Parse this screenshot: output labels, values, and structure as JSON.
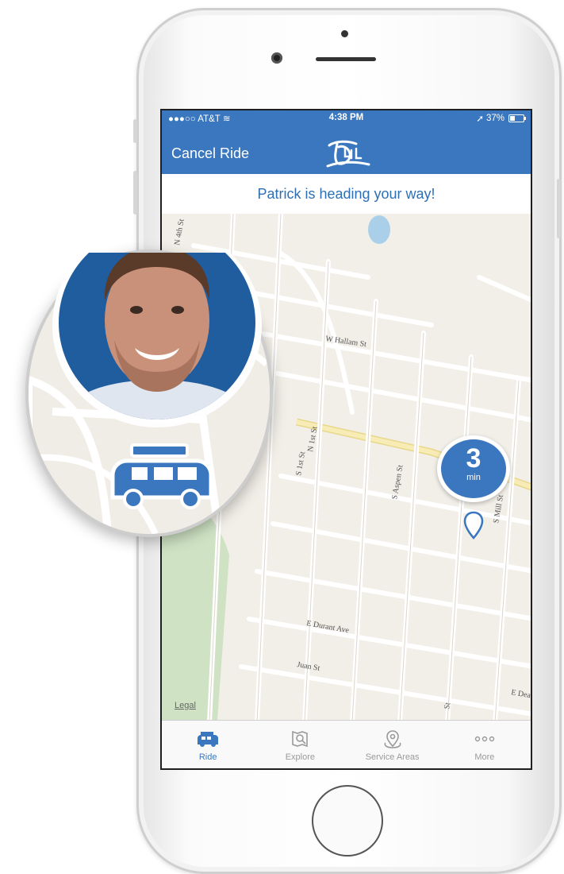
{
  "status_bar": {
    "carrier": "●●●○○ AT&T",
    "time": "4:38 PM",
    "battery": "37%"
  },
  "nav": {
    "cancel_label": "Cancel Ride"
  },
  "banner": {
    "message": "Patrick is heading your way!"
  },
  "eta": {
    "value": "3",
    "unit": "min"
  },
  "map": {
    "legal_label": "Legal",
    "streets": [
      "N 4th St",
      "W Hallam St",
      "N 1st St",
      "S 1st St",
      "S Aspen St",
      "S Mill St",
      "E Durant Ave",
      "Juan St",
      "E Dea",
      "St"
    ]
  },
  "tabs": [
    {
      "label": "Ride",
      "icon": "car-icon"
    },
    {
      "label": "Explore",
      "icon": "map-search-icon"
    },
    {
      "label": "Service Areas",
      "icon": "location-pin-icon"
    },
    {
      "label": "More",
      "icon": "more-dots-icon"
    }
  ],
  "colors": {
    "brand_blue": "#3a77bf",
    "map_bg": "#f2efe8",
    "park_green": "#cfe3c4",
    "highway_yellow": "#f6e8a6"
  }
}
